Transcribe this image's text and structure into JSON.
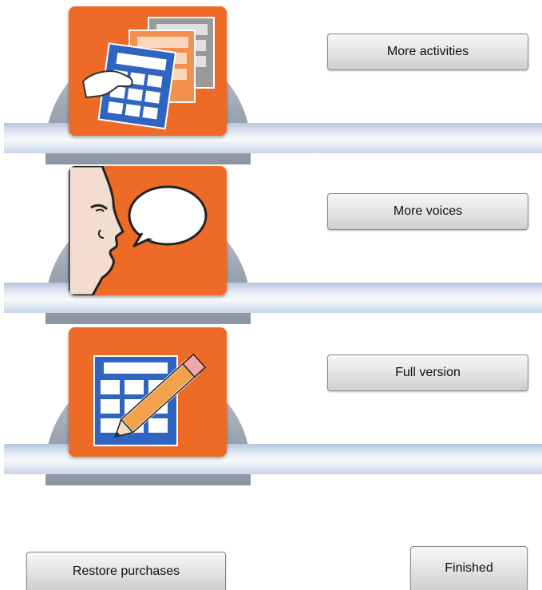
{
  "rows": [
    {
      "button_label": "More activities",
      "icon": "activity-cards-icon"
    },
    {
      "button_label": "More voices",
      "icon": "speaking-face-icon"
    },
    {
      "button_label": "Full version",
      "icon": "edit-grid-pencil-icon"
    }
  ],
  "footer": {
    "restore_label": "Restore purchases",
    "finished_label": "Finished"
  },
  "colors": {
    "tile_orange": "#ee6a27",
    "grid_blue": "#2f64c0",
    "shelf_blue": "#b8c7dc"
  }
}
